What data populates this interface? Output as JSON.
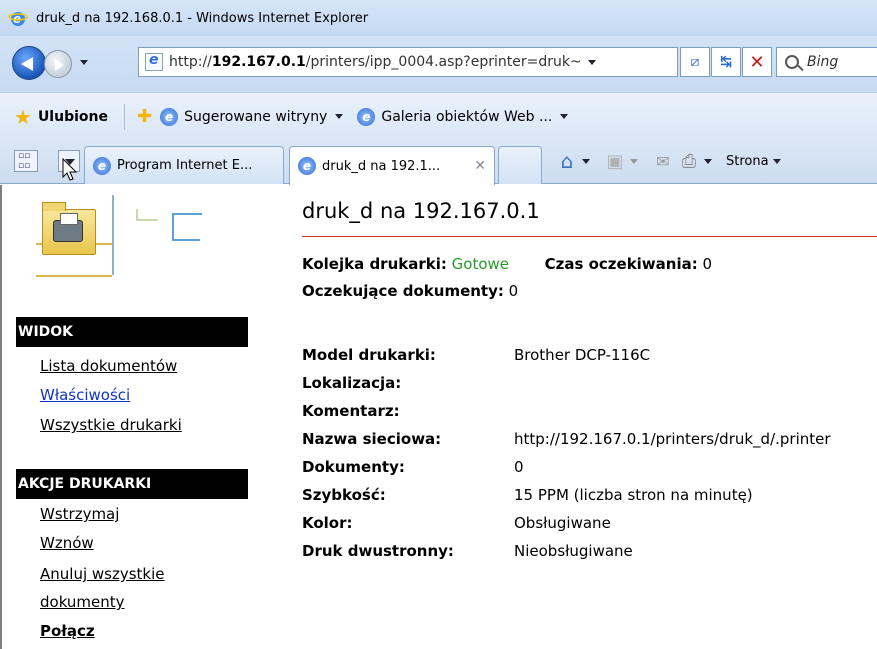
{
  "window": {
    "title": "druk_d na 192.168.0.1 - Windows Internet Explorer"
  },
  "address_bar": {
    "url_prefix": "http://",
    "url_host": "192.167.0.1",
    "url_rest": "/printers/ipp_0004.asp?eprinter=druk~",
    "search_placeholder": "Bing"
  },
  "favorites_bar": {
    "favorites_label": "Ulubione",
    "items": [
      {
        "label": "Sugerowane witryny"
      },
      {
        "label": "Galeria obiektów Web ..."
      }
    ]
  },
  "tabs": [
    {
      "label": "Program Internet E..."
    },
    {
      "label": "druk_d na 192.1...",
      "active": true
    }
  ],
  "command_bar": {
    "page_label": "Strona"
  },
  "sidebar": {
    "view_header": "WIDOK",
    "view_links": [
      {
        "label": "Lista dokumentów"
      },
      {
        "label": "Właściwości"
      },
      {
        "label": "Wszystkie drukarki"
      }
    ],
    "actions_header": "AKCJE DRUKARKI",
    "action_links": [
      {
        "label": "Wstrzymaj"
      },
      {
        "label": "Wznów"
      },
      {
        "label": "Anuluj wszystkie"
      },
      {
        "label": "dokumenty"
      },
      {
        "label": "Połącz"
      }
    ]
  },
  "main": {
    "title": "druk_d na 192.167.0.1",
    "queue_label": "Kolejka drukarki:",
    "queue_value": "Gotowe",
    "wait_label": "Czas oczekiwania:",
    "wait_value": "0",
    "pending_label": "Oczekujące dokumenty:",
    "pending_value": "0",
    "properties": [
      {
        "label": "Model drukarki:",
        "value": "Brother DCP-116C"
      },
      {
        "label": "Lokalizacja:",
        "value": ""
      },
      {
        "label": "Komentarz:",
        "value": ""
      },
      {
        "label": "Nazwa sieciowa:",
        "value": "http://192.167.0.1/printers/druk_d/.printer"
      },
      {
        "label": "Dokumenty:",
        "value": "0"
      },
      {
        "label": "Szybkość:",
        "value": "15 PPM (liczba stron na minutę)"
      },
      {
        "label": "Kolor:",
        "value": "Obsługiwane"
      },
      {
        "label": "Druk dwustronny:",
        "value": "Nieobsługiwane"
      }
    ]
  },
  "colors": {
    "status_ok": "#2a9a2a",
    "title_rule": "#cc2b2b",
    "link_visited": "#1133cc"
  }
}
